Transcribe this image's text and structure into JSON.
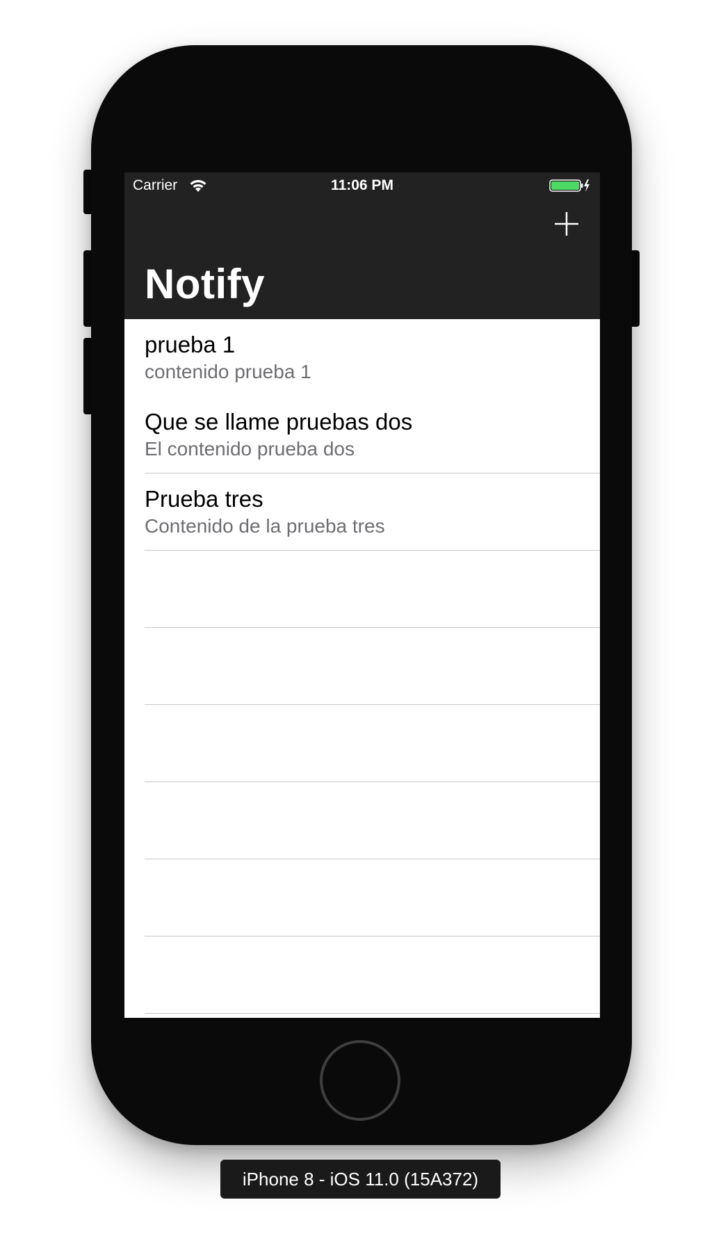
{
  "status_bar": {
    "carrier": "Carrier",
    "time": "11:06 PM",
    "wifi_icon": "wifi-icon",
    "battery_icon": "battery-charging-icon",
    "battery_color": "#4cd964"
  },
  "nav": {
    "title": "Notify",
    "add_icon": "plus-icon",
    "background": "#222222"
  },
  "notes": [
    {
      "title": "prueba 1",
      "subtitle": "contenido prueba 1"
    },
    {
      "title": "Que se llame pruebas dos",
      "subtitle": "El contenido prueba dos"
    },
    {
      "title": "Prueba tres",
      "subtitle": "Contenido de la prueba tres"
    }
  ],
  "device": {
    "label": "iPhone 8 - iOS 11.0 (15A372)",
    "home_button_icon": "home-button-icon"
  }
}
